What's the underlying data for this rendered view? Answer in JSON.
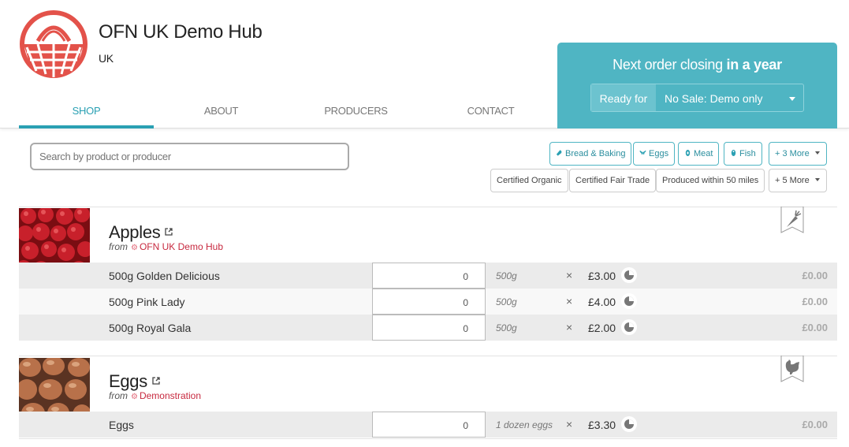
{
  "hub": {
    "name": "OFN UK Demo Hub",
    "country": "UK"
  },
  "tabs": [
    {
      "label": "SHOP"
    },
    {
      "label": "ABOUT"
    },
    {
      "label": "PRODUCERS"
    },
    {
      "label": "CONTACT"
    }
  ],
  "order": {
    "closing_prefix": "Next order closing ",
    "closing_strong": "in a year",
    "ready_label": "Ready for",
    "ready_value": "No Sale: Demo only"
  },
  "search": {
    "placeholder": "Search by product or producer"
  },
  "filters": {
    "categories": [
      "Bread & Baking",
      "Eggs",
      "Meat",
      "Fish"
    ],
    "categories_more": "+ 3 More",
    "properties": [
      "Certified Organic",
      "Certified Fair Trade",
      "Produced within 50 miles"
    ],
    "properties_more": "+ 5 More"
  },
  "products": [
    {
      "name": "Apples",
      "from_label": "from",
      "producer": "OFN UK Demo Hub",
      "badge_icon": "carrot-icon",
      "variants": [
        {
          "name": "500g Golden Delicious",
          "qty": "0",
          "unit": "500g",
          "times": "×",
          "price": "£3.00",
          "total": "£0.00"
        },
        {
          "name": "500g Pink Lady",
          "qty": "0",
          "unit": "500g",
          "times": "×",
          "price": "£4.00",
          "total": "£0.00"
        },
        {
          "name": "500g Royal Gala",
          "qty": "0",
          "unit": "500g",
          "times": "×",
          "price": "£2.00",
          "total": "£0.00"
        }
      ]
    },
    {
      "name": "Eggs",
      "from_label": "from",
      "producer": "Demonstration",
      "badge_icon": "chicken-icon",
      "variants": [
        {
          "name": "Eggs",
          "qty": "0",
          "unit": "1 dozen eggs",
          "times": "×",
          "price": "£3.30",
          "total": "£0.00"
        }
      ]
    }
  ],
  "colors": {
    "accent": "#4fb5c3",
    "tab_active": "#2aa0b3",
    "producer_link": "#c7293f",
    "logo": "#e3524a"
  }
}
